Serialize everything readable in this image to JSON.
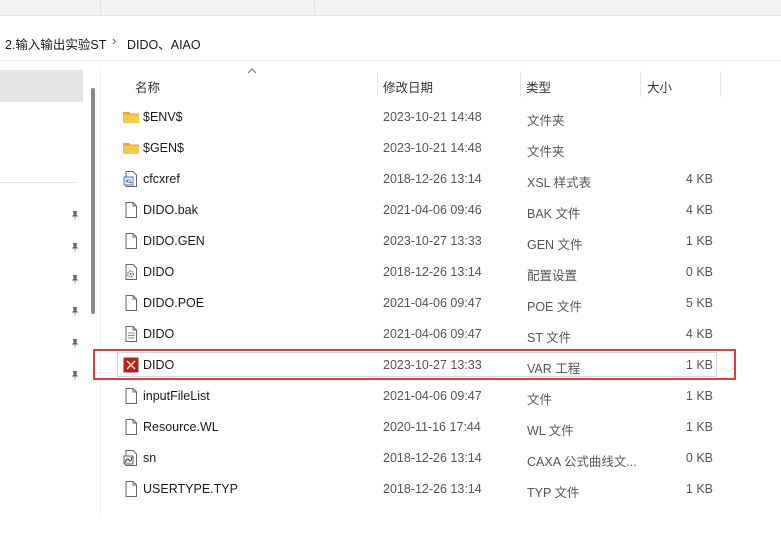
{
  "breadcrumb": {
    "items": [
      "2.输入输出实验ST",
      "DIDO、AIAO"
    ],
    "separator": "›"
  },
  "columns": {
    "name": "名称",
    "date": "修改日期",
    "type": "类型",
    "size": "大小"
  },
  "files": [
    {
      "name": "$ENV$",
      "date": "2023-10-21 14:48",
      "type": "文件夹",
      "size": "",
      "icon": "folder-icon"
    },
    {
      "name": "$GEN$",
      "date": "2023-10-21 14:48",
      "type": "文件夹",
      "size": "",
      "icon": "folder-icon"
    },
    {
      "name": "cfcxref",
      "date": "2018-12-26 13:14",
      "type": "XSL 样式表",
      "size": "4 KB",
      "icon": "xsl-file-icon"
    },
    {
      "name": "DIDO.bak",
      "date": "2021-04-06 09:46",
      "type": "BAK 文件",
      "size": "4 KB",
      "icon": "blank-file-icon"
    },
    {
      "name": "DIDO.GEN",
      "date": "2023-10-27 13:33",
      "type": "GEN 文件",
      "size": "1 KB",
      "icon": "blank-file-icon"
    },
    {
      "name": "DIDO",
      "date": "2018-12-26 13:14",
      "type": "配置设置",
      "size": "0 KB",
      "icon": "config-file-icon"
    },
    {
      "name": "DIDO.POE",
      "date": "2021-04-06 09:47",
      "type": "POE 文件",
      "size": "5 KB",
      "icon": "blank-file-icon"
    },
    {
      "name": "DIDO",
      "date": "2021-04-06 09:47",
      "type": "ST 文件",
      "size": "4 KB",
      "icon": "text-file-icon"
    },
    {
      "name": "DIDO",
      "date": "2023-10-27 13:33",
      "type": "VAR 工程",
      "size": "1 KB",
      "icon": "var-project-icon",
      "highlighted": true
    },
    {
      "name": "inputFileList",
      "date": "2021-04-06 09:47",
      "type": "文件",
      "size": "1 KB",
      "icon": "blank-file-icon"
    },
    {
      "name": "Resource.WL",
      "date": "2020-11-16 17:44",
      "type": "WL 文件",
      "size": "1 KB",
      "icon": "blank-file-icon"
    },
    {
      "name": "sn",
      "date": "2018-12-26 13:14",
      "type": "CAXA 公式曲线文...",
      "size": "0 KB",
      "icon": "caxa-file-icon"
    },
    {
      "name": "USERTYPE.TYP",
      "date": "2018-12-26 13:14",
      "type": "TYP 文件",
      "size": "1 KB",
      "icon": "blank-file-icon"
    }
  ],
  "colors": {
    "highlight_border": "#e53b3b",
    "folder": "#f5c242",
    "var_icon": "#b5211f"
  }
}
